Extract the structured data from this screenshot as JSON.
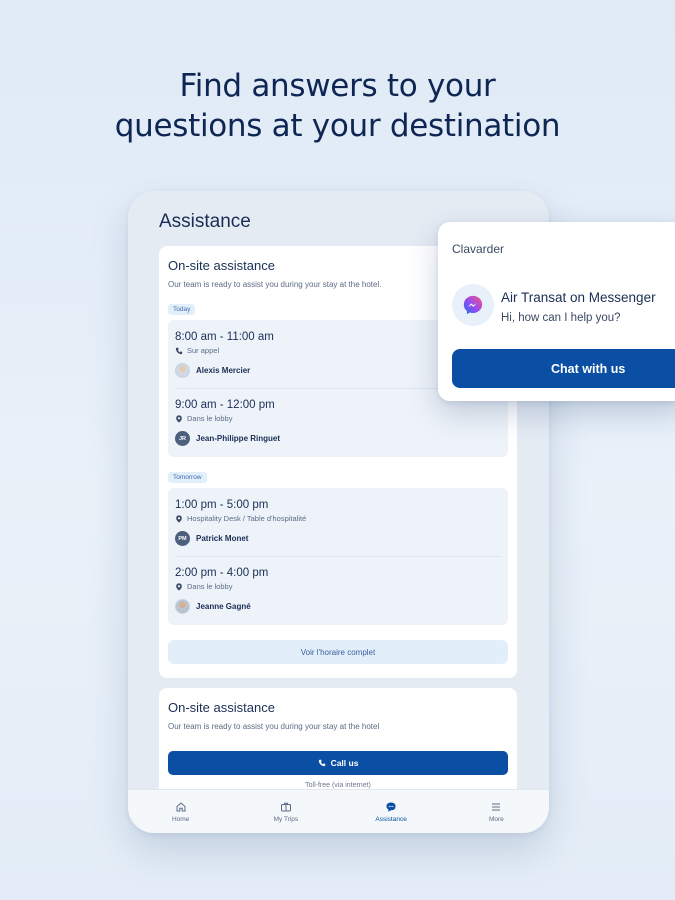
{
  "headline": {
    "line1": "Find answers to your",
    "line2": "questions at your destination"
  },
  "screen": {
    "title": "Assistance",
    "onsite_card": {
      "title": "On-site assistance",
      "subtitle": "Our team is ready to assist you during your stay at the hotel.",
      "days": [
        {
          "tag": "Today",
          "slots": [
            {
              "time": "8:00 am - 11:00 am",
              "location": "Sur appel",
              "location_icon": "phone-icon",
              "person": "Alexis Mercier",
              "avatar": ""
            },
            {
              "time": "9:00 am - 12:00 pm",
              "location": "Dans le lobby",
              "location_icon": "pin-icon",
              "person": "Jean-Philippe Ringuet",
              "avatar": "JR"
            }
          ]
        },
        {
          "tag": "Tomorrow",
          "slots": [
            {
              "time": "1:00 pm - 5:00 pm",
              "location": "Hospitality Desk / Table d'hospitalité",
              "location_icon": "pin-icon",
              "person": "Patrick Monet",
              "avatar": "PM"
            },
            {
              "time": "2:00 pm - 4:00 pm",
              "location": "Dans le lobby",
              "location_icon": "pin-icon",
              "person": "Jeanne Gagné",
              "avatar": ""
            }
          ]
        }
      ],
      "schedule_button": "Voir l'horaire complet"
    },
    "call_card": {
      "title": "On-site assistance",
      "subtitle": "Our team is ready to assist you during your stay at the hotel",
      "call_button": "Call us",
      "tollfree": "Toll-free (via internet)"
    },
    "nav": [
      {
        "label": "Home",
        "icon": "home-icon",
        "active": false
      },
      {
        "label": "My Trips",
        "icon": "suitcase-icon",
        "active": false
      },
      {
        "label": "Assistance",
        "icon": "chat-bubble-icon",
        "active": true
      },
      {
        "label": "More",
        "icon": "menu-icon",
        "active": false
      }
    ]
  },
  "popup": {
    "title": "Clavarder",
    "app_name": "Air Transat on Messenger",
    "greeting": "Hi, how can I help you?",
    "button": "Chat with us"
  },
  "colors": {
    "brand_blue": "#0a4fa3",
    "navy_text": "#0f2654",
    "tag_bg": "#e3eefb"
  }
}
